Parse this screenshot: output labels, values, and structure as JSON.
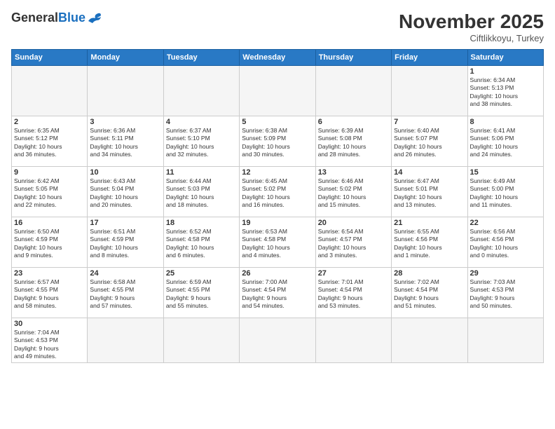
{
  "header": {
    "logo": {
      "general": "General",
      "blue": "Blue",
      "tagline": ""
    },
    "title": "November 2025",
    "location": "Ciftlikkoyu, Turkey"
  },
  "days_of_week": [
    "Sunday",
    "Monday",
    "Tuesday",
    "Wednesday",
    "Thursday",
    "Friday",
    "Saturday"
  ],
  "weeks": [
    [
      {
        "day": "",
        "info": "",
        "empty": true
      },
      {
        "day": "",
        "info": "",
        "empty": true
      },
      {
        "day": "",
        "info": "",
        "empty": true
      },
      {
        "day": "",
        "info": "",
        "empty": true
      },
      {
        "day": "",
        "info": "",
        "empty": true
      },
      {
        "day": "",
        "info": "",
        "empty": true
      },
      {
        "day": "1",
        "info": "Sunrise: 6:34 AM\nSunset: 5:13 PM\nDaylight: 10 hours\nand 38 minutes."
      }
    ],
    [
      {
        "day": "2",
        "info": "Sunrise: 6:35 AM\nSunset: 5:12 PM\nDaylight: 10 hours\nand 36 minutes."
      },
      {
        "day": "3",
        "info": "Sunrise: 6:36 AM\nSunset: 5:11 PM\nDaylight: 10 hours\nand 34 minutes."
      },
      {
        "day": "4",
        "info": "Sunrise: 6:37 AM\nSunset: 5:10 PM\nDaylight: 10 hours\nand 32 minutes."
      },
      {
        "day": "5",
        "info": "Sunrise: 6:38 AM\nSunset: 5:09 PM\nDaylight: 10 hours\nand 30 minutes."
      },
      {
        "day": "6",
        "info": "Sunrise: 6:39 AM\nSunset: 5:08 PM\nDaylight: 10 hours\nand 28 minutes."
      },
      {
        "day": "7",
        "info": "Sunrise: 6:40 AM\nSunset: 5:07 PM\nDaylight: 10 hours\nand 26 minutes."
      },
      {
        "day": "8",
        "info": "Sunrise: 6:41 AM\nSunset: 5:06 PM\nDaylight: 10 hours\nand 24 minutes."
      }
    ],
    [
      {
        "day": "9",
        "info": "Sunrise: 6:42 AM\nSunset: 5:05 PM\nDaylight: 10 hours\nand 22 minutes."
      },
      {
        "day": "10",
        "info": "Sunrise: 6:43 AM\nSunset: 5:04 PM\nDaylight: 10 hours\nand 20 minutes."
      },
      {
        "day": "11",
        "info": "Sunrise: 6:44 AM\nSunset: 5:03 PM\nDaylight: 10 hours\nand 18 minutes."
      },
      {
        "day": "12",
        "info": "Sunrise: 6:45 AM\nSunset: 5:02 PM\nDaylight: 10 hours\nand 16 minutes."
      },
      {
        "day": "13",
        "info": "Sunrise: 6:46 AM\nSunset: 5:02 PM\nDaylight: 10 hours\nand 15 minutes."
      },
      {
        "day": "14",
        "info": "Sunrise: 6:47 AM\nSunset: 5:01 PM\nDaylight: 10 hours\nand 13 minutes."
      },
      {
        "day": "15",
        "info": "Sunrise: 6:49 AM\nSunset: 5:00 PM\nDaylight: 10 hours\nand 11 minutes."
      }
    ],
    [
      {
        "day": "16",
        "info": "Sunrise: 6:50 AM\nSunset: 4:59 PM\nDaylight: 10 hours\nand 9 minutes."
      },
      {
        "day": "17",
        "info": "Sunrise: 6:51 AM\nSunset: 4:59 PM\nDaylight: 10 hours\nand 8 minutes."
      },
      {
        "day": "18",
        "info": "Sunrise: 6:52 AM\nSunset: 4:58 PM\nDaylight: 10 hours\nand 6 minutes."
      },
      {
        "day": "19",
        "info": "Sunrise: 6:53 AM\nSunset: 4:58 PM\nDaylight: 10 hours\nand 4 minutes."
      },
      {
        "day": "20",
        "info": "Sunrise: 6:54 AM\nSunset: 4:57 PM\nDaylight: 10 hours\nand 3 minutes."
      },
      {
        "day": "21",
        "info": "Sunrise: 6:55 AM\nSunset: 4:56 PM\nDaylight: 10 hours\nand 1 minute."
      },
      {
        "day": "22",
        "info": "Sunrise: 6:56 AM\nSunset: 4:56 PM\nDaylight: 10 hours\nand 0 minutes."
      }
    ],
    [
      {
        "day": "23",
        "info": "Sunrise: 6:57 AM\nSunset: 4:55 PM\nDaylight: 9 hours\nand 58 minutes."
      },
      {
        "day": "24",
        "info": "Sunrise: 6:58 AM\nSunset: 4:55 PM\nDaylight: 9 hours\nand 57 minutes."
      },
      {
        "day": "25",
        "info": "Sunrise: 6:59 AM\nSunset: 4:55 PM\nDaylight: 9 hours\nand 55 minutes."
      },
      {
        "day": "26",
        "info": "Sunrise: 7:00 AM\nSunset: 4:54 PM\nDaylight: 9 hours\nand 54 minutes."
      },
      {
        "day": "27",
        "info": "Sunrise: 7:01 AM\nSunset: 4:54 PM\nDaylight: 9 hours\nand 53 minutes."
      },
      {
        "day": "28",
        "info": "Sunrise: 7:02 AM\nSunset: 4:54 PM\nDaylight: 9 hours\nand 51 minutes."
      },
      {
        "day": "29",
        "info": "Sunrise: 7:03 AM\nSunset: 4:53 PM\nDaylight: 9 hours\nand 50 minutes."
      }
    ],
    [
      {
        "day": "30",
        "info": "Sunrise: 7:04 AM\nSunset: 4:53 PM\nDaylight: 9 hours\nand 49 minutes."
      },
      {
        "day": "",
        "info": "",
        "empty": true
      },
      {
        "day": "",
        "info": "",
        "empty": true
      },
      {
        "day": "",
        "info": "",
        "empty": true
      },
      {
        "day": "",
        "info": "",
        "empty": true
      },
      {
        "day": "",
        "info": "",
        "empty": true
      },
      {
        "day": "",
        "info": "",
        "empty": true
      }
    ]
  ]
}
